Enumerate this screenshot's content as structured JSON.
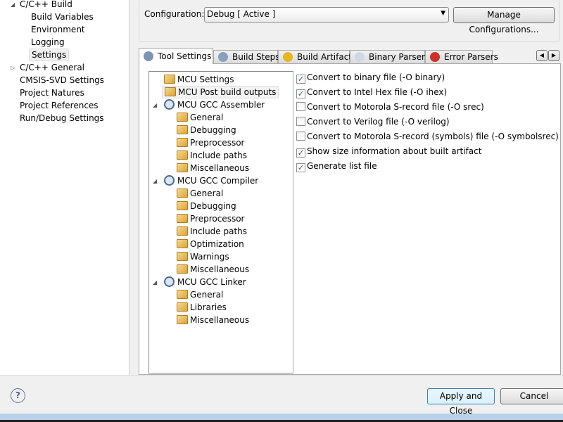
{
  "sidebar": {
    "items": [
      {
        "label": "C/C++ Build",
        "expanded": true
      },
      {
        "label": "Build Variables"
      },
      {
        "label": "Environment"
      },
      {
        "label": "Logging"
      },
      {
        "label": "Settings",
        "selected": true
      },
      {
        "label": "C/C++ General",
        "expanded": false
      },
      {
        "label": "CMSIS-SVD Settings"
      },
      {
        "label": "Project Natures"
      },
      {
        "label": "Project References"
      },
      {
        "label": "Run/Debug Settings"
      }
    ]
  },
  "config": {
    "label": "Configuration:",
    "value": "Debug  [ Active ]",
    "manage_label": "Manage Configurations..."
  },
  "tabs": [
    {
      "label": "Tool Settings",
      "icon": "tool-settings-icon",
      "active": true
    },
    {
      "label": "Build Steps",
      "icon": "build-steps-icon"
    },
    {
      "label": "Build Artifact",
      "icon": "trophy-icon"
    },
    {
      "label": "Binary Parsers",
      "icon": "binary-icon"
    },
    {
      "label": "Error Parsers",
      "icon": "error-icon"
    }
  ],
  "tree": [
    {
      "label": "MCU Settings",
      "level": 1
    },
    {
      "label": "MCU Post build outputs",
      "level": 1,
      "selected": true
    },
    {
      "label": "MCU GCC Assembler",
      "level": 0
    },
    {
      "label": "General",
      "level": 2
    },
    {
      "label": "Debugging",
      "level": 2
    },
    {
      "label": "Preprocessor",
      "level": 2
    },
    {
      "label": "Include paths",
      "level": 2
    },
    {
      "label": "Miscellaneous",
      "level": 2
    },
    {
      "label": "MCU GCC Compiler",
      "level": 0
    },
    {
      "label": "General",
      "level": 2
    },
    {
      "label": "Debugging",
      "level": 2
    },
    {
      "label": "Preprocessor",
      "level": 2
    },
    {
      "label": "Include paths",
      "level": 2
    },
    {
      "label": "Optimization",
      "level": 2
    },
    {
      "label": "Warnings",
      "level": 2
    },
    {
      "label": "Miscellaneous",
      "level": 2
    },
    {
      "label": "MCU GCC Linker",
      "level": 0
    },
    {
      "label": "General",
      "level": 2
    },
    {
      "label": "Libraries",
      "level": 2
    },
    {
      "label": "Miscellaneous",
      "level": 2
    }
  ],
  "options": [
    {
      "label": "Convert to binary file (-O binary)",
      "checked": true
    },
    {
      "label": "Convert to Intel Hex file (-O ihex)",
      "checked": true
    },
    {
      "label": "Convert to Motorola S-record file (-O srec)",
      "checked": false
    },
    {
      "label": "Convert to Verilog file (-O verilog)",
      "checked": false
    },
    {
      "label": "Convert to Motorola S-record (symbols) file (-O symbolsrec)",
      "checked": false
    },
    {
      "label": "Show size information about built artifact",
      "checked": true
    },
    {
      "label": "Generate list file",
      "checked": true
    }
  ],
  "footer": {
    "apply_label": "Apply and Close",
    "cancel_label": "Cancel"
  }
}
